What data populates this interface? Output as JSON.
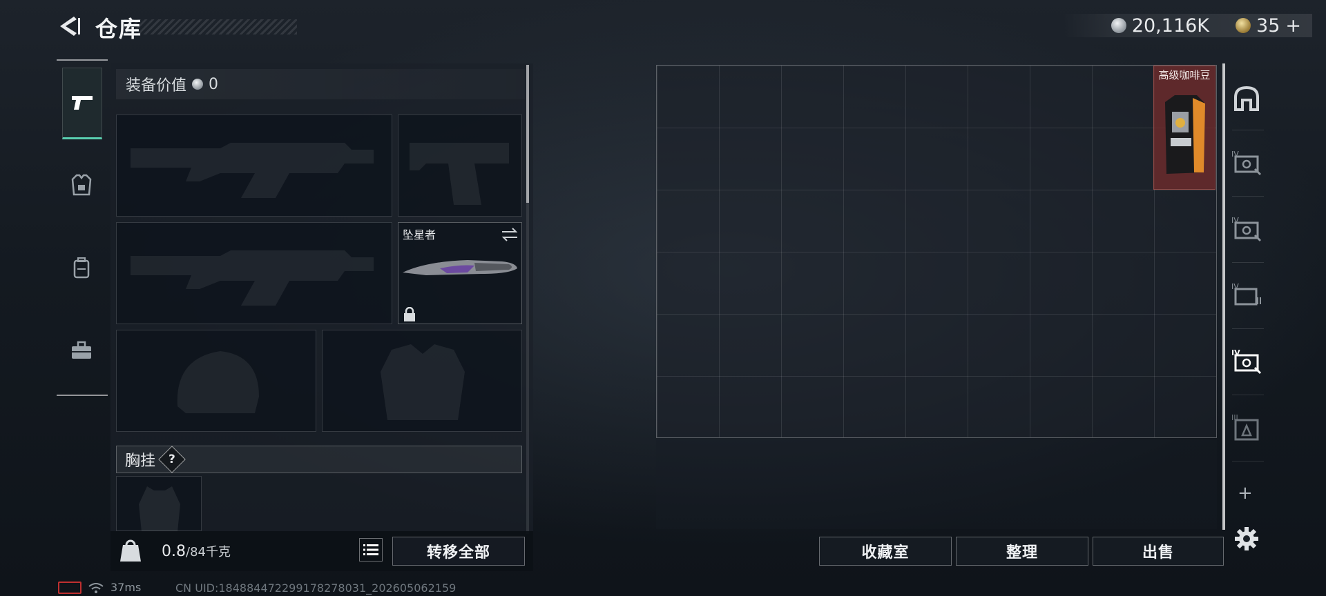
{
  "header": {
    "title": "仓库",
    "silver_amount": "20,116K",
    "gold_amount": "35",
    "plus": "+"
  },
  "equipment": {
    "value_label": "装备价值",
    "value": "0",
    "melee_name": "坠星者",
    "chest_rig_label": "胸挂",
    "chest_rig_badge": "?"
  },
  "inventory": {
    "weight_current": "0.8",
    "weight_max": "/84千克",
    "transfer_all": "转移全部"
  },
  "storage": {
    "item_name": "高级咖啡豆",
    "add": "+",
    "collection_button": "收藏室",
    "sort_button": "整理",
    "sell_button": "出售"
  },
  "status_bar": {
    "ping": "37ms",
    "uid": "CN UID:184884472299178278031_202605062159"
  },
  "colors": {
    "accent_teal": "#59d0b0",
    "item_tile_red": "#782c2c",
    "battery_red": "#c03030"
  }
}
